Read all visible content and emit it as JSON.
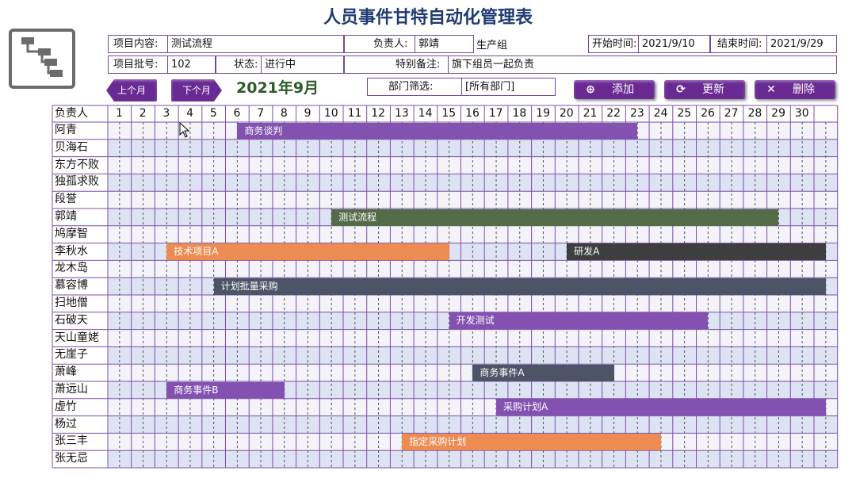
{
  "title": "人员事件甘特自动化管理表",
  "info": {
    "project_label": "项目内容:",
    "project_value": "测试流程",
    "owner_label": "负责人:",
    "owner_value": "郭靖",
    "group_value": "生产组",
    "start_label": "开始时间:",
    "start_value": "2021/9/10",
    "end_label": "结束时间:",
    "end_value": "2021/9/29",
    "batch_label": "项目批号:",
    "batch_value": "102",
    "status_label": "状态:",
    "status_value": "进行中",
    "note_label": "特别备注:",
    "note_value": "旗下组员一起负责",
    "dept_label": "部门筛选:",
    "dept_value": "[所有部门]"
  },
  "nav": {
    "prev_label": "上个月",
    "next_label": "下个月",
    "month_label": "2021年9月"
  },
  "actions": [
    {
      "label": "添加",
      "icon": "plus-circle-icon",
      "glyph": "⊕"
    },
    {
      "label": "更新",
      "icon": "refresh-icon",
      "glyph": "⟳"
    },
    {
      "label": "删除",
      "icon": "close-icon",
      "glyph": "✕"
    }
  ],
  "gantt": {
    "header_label": "负责人",
    "days": [
      "1",
      "2",
      "3",
      "4",
      "5",
      "6",
      "7",
      "8",
      "9",
      "10",
      "11",
      "12",
      "13",
      "14",
      "15",
      "16",
      "17",
      "18",
      "19",
      "20",
      "21",
      "22",
      "23",
      "24",
      "25",
      "26",
      "27",
      "28",
      "29",
      "30"
    ],
    "people": [
      "阿青",
      "贝海石",
      "东方不败",
      "独孤求败",
      "段誉",
      "郭靖",
      "鸠摩智",
      "李秋水",
      "龙木岛",
      "慕容博",
      "扫地僧",
      "石破天",
      "天山童姥",
      "无崖子",
      "萧峰",
      "萧远山",
      "虚竹",
      "杨过",
      "张三丰",
      "张无忌"
    ],
    "tasks": [
      {
        "row": 0,
        "label": "商务谈判",
        "start": 6,
        "end": 22,
        "color": "#8352b0"
      },
      {
        "row": 5,
        "label": "测试流程",
        "start": 10,
        "end": 28,
        "color": "#546b48"
      },
      {
        "row": 7,
        "label": "技术项目A",
        "start": 3,
        "end": 14,
        "color": "#ec8c52"
      },
      {
        "row": 7,
        "label": "研发A",
        "start": 20,
        "end": 30,
        "color": "#3e3e40"
      },
      {
        "row": 9,
        "label": "计划批量采购",
        "start": 5,
        "end": 30,
        "color": "#4c5466"
      },
      {
        "row": 11,
        "label": "开发测试",
        "start": 15,
        "end": 25,
        "color": "#8352b0"
      },
      {
        "row": 14,
        "label": "商务事件A",
        "start": 16,
        "end": 21,
        "color": "#4c5466"
      },
      {
        "row": 15,
        "label": "商务事件B",
        "start": 3,
        "end": 7,
        "color": "#8352b0"
      },
      {
        "row": 16,
        "label": "采购计划A",
        "start": 17,
        "end": 30,
        "color": "#8352b0"
      },
      {
        "row": 18,
        "label": "指定采购计划",
        "start": 13,
        "end": 23,
        "color": "#ec8c52"
      }
    ]
  },
  "colors": {
    "grid_line": "#7b4fa8",
    "row_a": "#f3f3f9",
    "row_b": "#dde3f2",
    "accent": "#6a2a94"
  }
}
